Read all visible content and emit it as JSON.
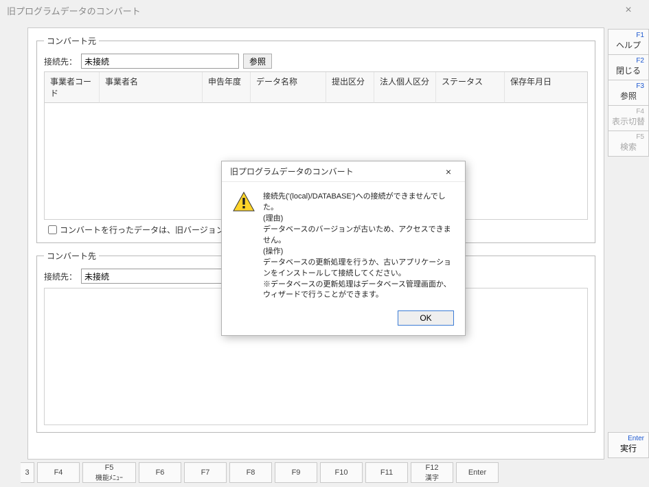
{
  "window": {
    "title": "旧プログラムデータのコンバート",
    "close_glyph": "×"
  },
  "source": {
    "legend": "コンバート元",
    "connect_label": "接続先：",
    "connect_value": "未接続",
    "browse_label": "参照",
    "columns": [
      "事業者コード",
      "事業者名",
      "申告年度",
      "データ名称",
      "提出区分",
      "法人個人区分",
      "ステータス",
      "保存年月日"
    ],
    "checkbox_label": "コンバートを行ったデータは、旧バージョン"
  },
  "dest": {
    "legend": "コンバート先",
    "connect_label": "接続先：",
    "connect_value": "未接続"
  },
  "right_fkeys": [
    {
      "num": "F1",
      "label": "ヘルプ",
      "disabled": false
    },
    {
      "num": "F2",
      "label": "閉じる",
      "disabled": false
    },
    {
      "num": "F3",
      "label": "参照",
      "disabled": false
    },
    {
      "num": "F4",
      "label": "表示切替",
      "disabled": true
    },
    {
      "num": "F5",
      "label": "検索",
      "disabled": true
    }
  ],
  "right_enter": {
    "num": "Enter",
    "label": "実行"
  },
  "bottom_fkeys": [
    {
      "name": "3",
      "sub": ""
    },
    {
      "name": "F4",
      "sub": ""
    },
    {
      "name": "F5",
      "sub": "機能ﾒﾆｭｰ"
    },
    {
      "name": "F6",
      "sub": ""
    },
    {
      "name": "F7",
      "sub": ""
    },
    {
      "name": "F8",
      "sub": ""
    },
    {
      "name": "F9",
      "sub": ""
    },
    {
      "name": "F10",
      "sub": ""
    },
    {
      "name": "F11",
      "sub": ""
    },
    {
      "name": "F12",
      "sub": "漢字"
    },
    {
      "name": "Enter",
      "sub": ""
    }
  ],
  "dialog": {
    "title": "旧プログラムデータのコンバート",
    "close_glyph": "×",
    "lines": [
      "接続先('(local)/DATABASE')への接続ができませんでした。",
      "(理由)",
      "データベースのバージョンが古いため、アクセスできません。",
      "(操作)",
      "データベースの更新処理を行うか、古いアプリケーションをインストールして接続してください。",
      "※データベースの更新処理はデータベース管理画面か、ウィザードで行うことができます。"
    ],
    "ok_label": "OK"
  }
}
